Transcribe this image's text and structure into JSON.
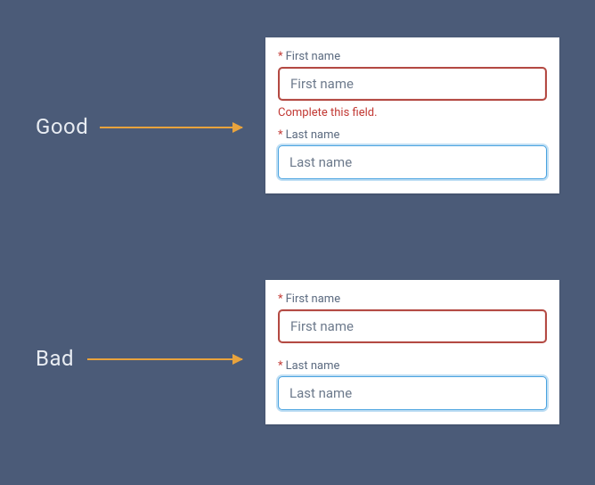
{
  "captions": {
    "good": "Good",
    "bad": "Bad"
  },
  "good_example": {
    "first": {
      "label": "First name",
      "placeholder": "First name",
      "error": "Complete this field."
    },
    "last": {
      "label": "Last name",
      "placeholder": "Last name"
    }
  },
  "bad_example": {
    "first": {
      "label": "First name",
      "placeholder": "First name"
    },
    "last": {
      "label": "Last name",
      "placeholder": "Last name"
    }
  },
  "colors": {
    "bg": "#4b5b78",
    "arrow": "#e8a33d",
    "error": "#c23934",
    "focus": "#4aa3e0"
  }
}
